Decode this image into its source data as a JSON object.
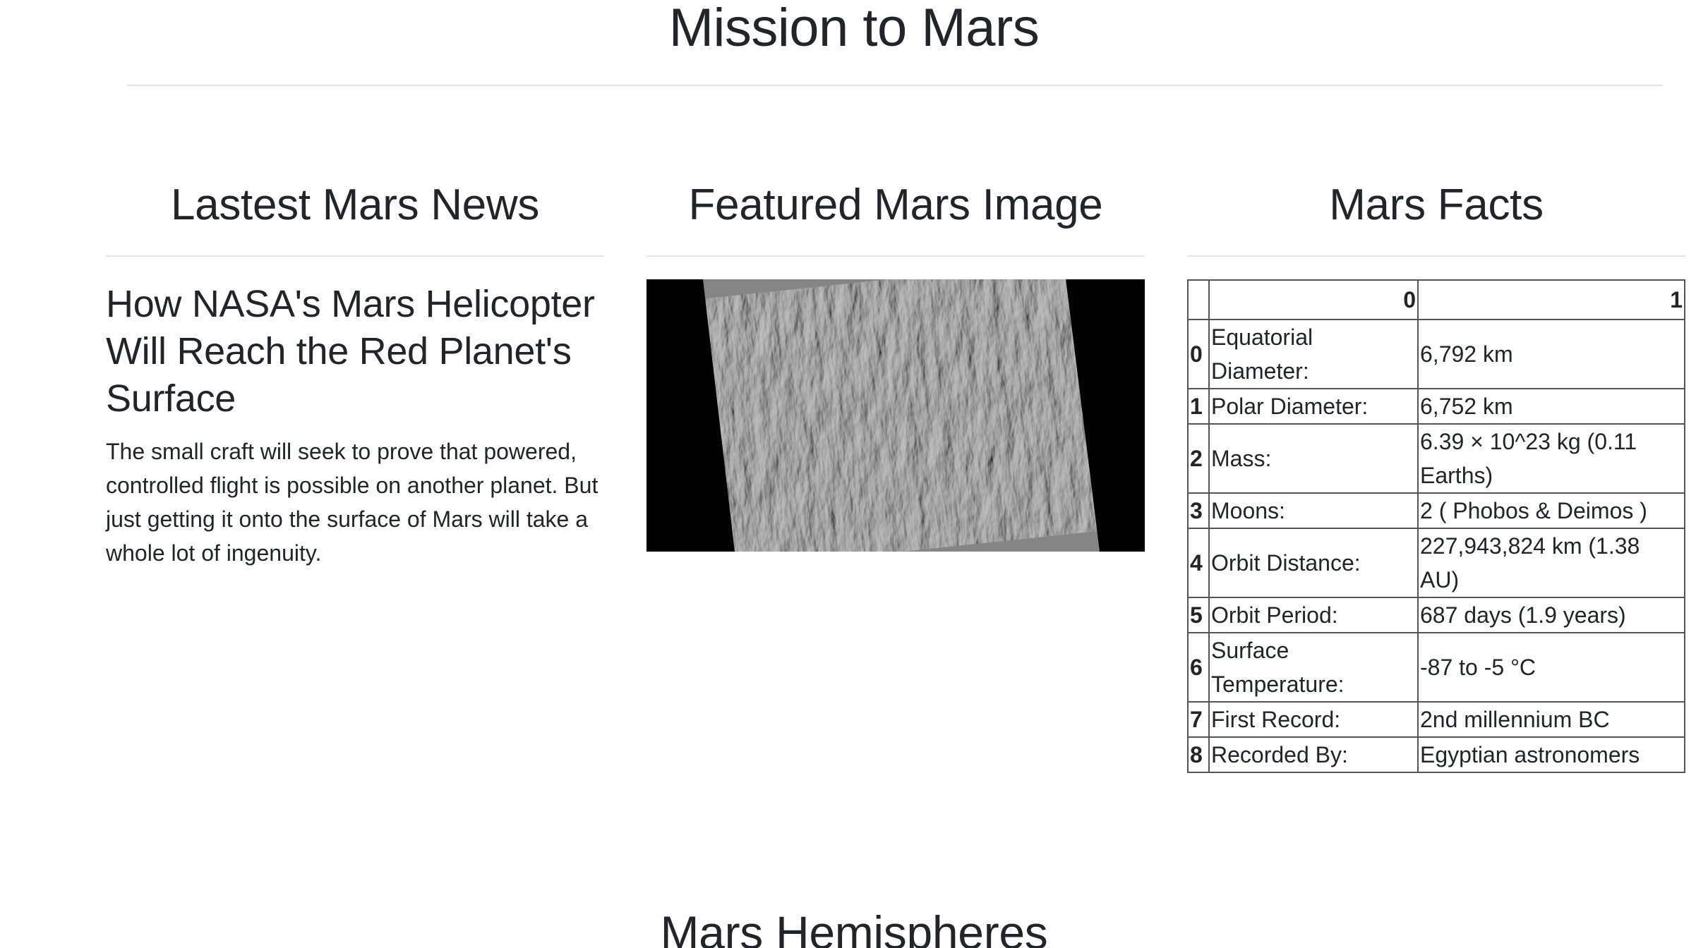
{
  "header": {
    "title": "Mission to Mars"
  },
  "news": {
    "heading": "Lastest Mars News",
    "article_title": "How NASA's Mars Helicopter Will Reach the Red Planet's Surface",
    "article_teaser": "The small craft will seek to prove that powered, controlled flight is possible on another planet. But just getting it onto the surface of Mars will take a whole lot of ingenuity."
  },
  "featured": {
    "heading": "Featured Mars Image"
  },
  "facts": {
    "heading": "Mars Facts",
    "columns": [
      "",
      "0",
      "1"
    ],
    "rows": [
      {
        "index": "0",
        "label": "Equatorial Diameter:",
        "value": "6,792 km"
      },
      {
        "index": "1",
        "label": "Polar Diameter:",
        "value": "6,752 km"
      },
      {
        "index": "2",
        "label": "Mass:",
        "value": "6.39 × 10^23 kg (0.11 Earths)"
      },
      {
        "index": "3",
        "label": "Moons:",
        "value": "2 ( Phobos & Deimos )"
      },
      {
        "index": "4",
        "label": "Orbit Distance:",
        "value": "227,943,824 km (1.38 AU)"
      },
      {
        "index": "5",
        "label": "Orbit Period:",
        "value": "687 days (1.9 years)"
      },
      {
        "index": "6",
        "label": "Surface Temperature:",
        "value": "-87 to -5 °C"
      },
      {
        "index": "7",
        "label": "First Record:",
        "value": "2nd millennium BC"
      },
      {
        "index": "8",
        "label": "Recorded By:",
        "value": "Egyptian astronomers"
      }
    ]
  },
  "hemispheres": {
    "heading": "Mars Hemispheres"
  }
}
